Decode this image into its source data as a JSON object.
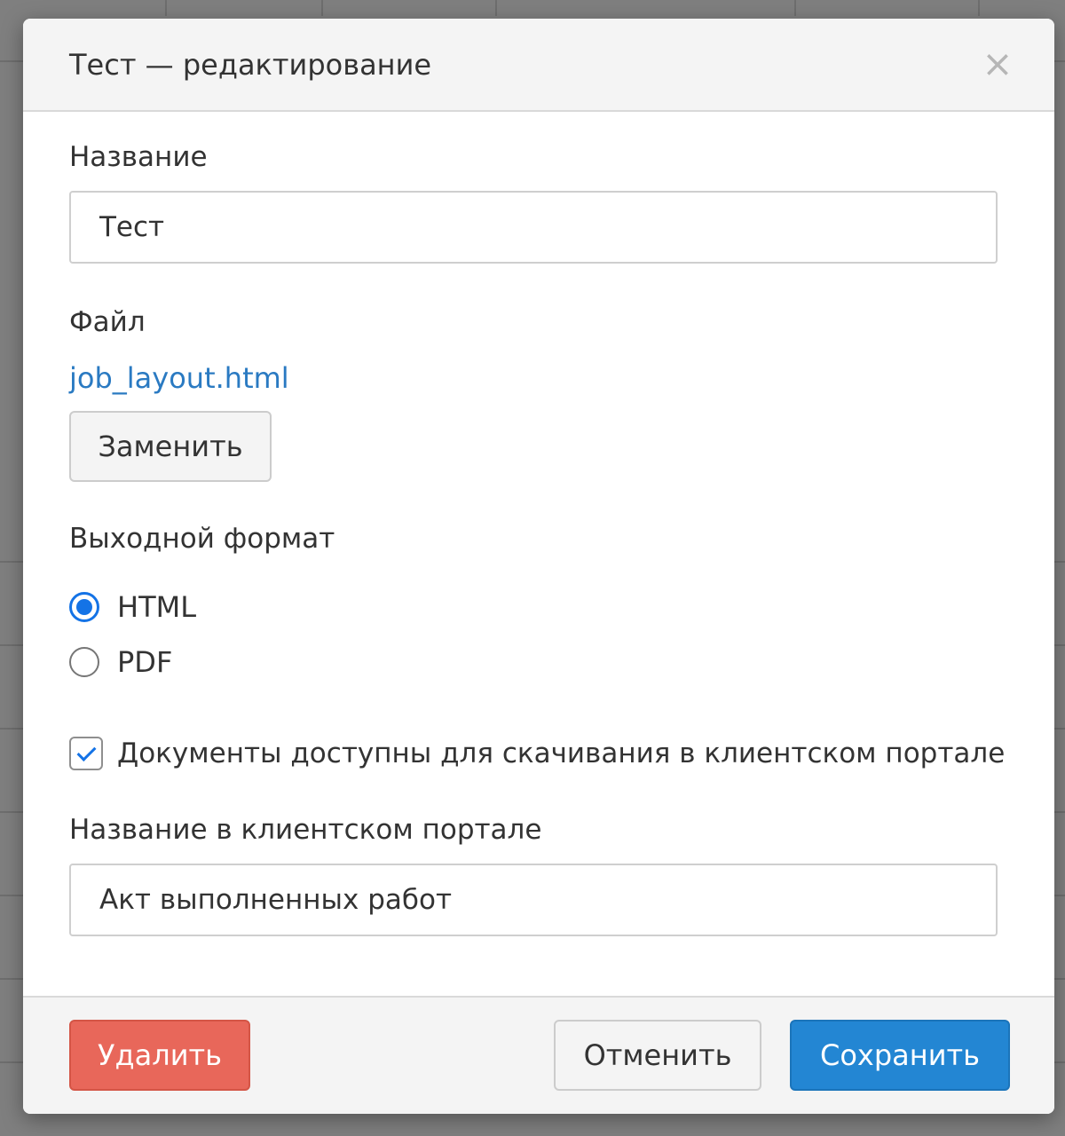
{
  "modal": {
    "title": "Тест — редактирование",
    "close_glyph": "×"
  },
  "form": {
    "name_label": "Название",
    "name_value": "Тест",
    "file_label": "Файл",
    "file_name": "job_layout.html",
    "replace_label": "Заменить",
    "format_label": "Выходной формат",
    "format_options": [
      {
        "label": "HTML",
        "checked": true
      },
      {
        "label": "PDF",
        "checked": false
      }
    ],
    "portal_checkbox_label": "Документы доступны для скачивания в клиентском портале",
    "portal_checkbox_checked": true,
    "portal_name_label": "Название в клиентском портале",
    "portal_name_value": "Акт выполненных работ"
  },
  "footer": {
    "delete_label": "Удалить",
    "cancel_label": "Отменить",
    "save_label": "Сохранить"
  },
  "colors": {
    "primary": "#2386d3",
    "danger": "#e8675a",
    "link": "#2a7ac2",
    "radio_accent": "#1473e6"
  }
}
